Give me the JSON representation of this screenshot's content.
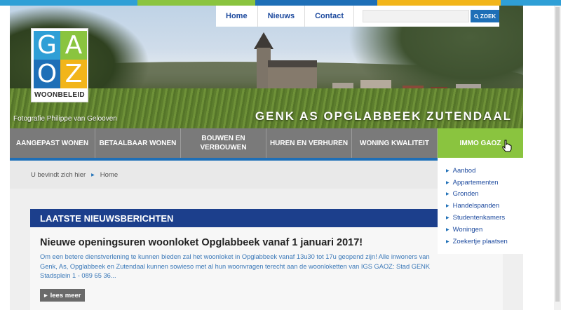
{
  "colors": {
    "top_strip": [
      "#2f9fd6",
      "#8ac43f",
      "#1e6fb7",
      "#f2b51a",
      "#2f9fd6"
    ],
    "logo_cells": [
      "#2f9fd6",
      "#8ac43f",
      "#1e6fb7",
      "#f2b51a"
    ],
    "accent_blue": "#1c3f8c",
    "active_green": "#8ac43f"
  },
  "logo": {
    "letters": [
      "G",
      "A",
      "O",
      "Z"
    ],
    "subtitle": "WOONBELEID"
  },
  "header": {
    "photo_credit": "Fotografie Philippe van Gelooven",
    "tagline": "GENK AS OPGLABBEEK ZUTENDAAL"
  },
  "topnav": {
    "links": [
      "Home",
      "Nieuws",
      "Contact"
    ],
    "search_placeholder": "",
    "search_button": "ZOEK",
    "search_icon": "search-icon"
  },
  "mainnav": {
    "items": [
      {
        "label": "AANGEPAST WONEN"
      },
      {
        "label": "BETAALBAAR WONEN"
      },
      {
        "label": "BOUWEN EN VERBOUWEN"
      },
      {
        "label": "HUREN EN VERHUREN"
      },
      {
        "label": "WONING KWALITEIT"
      },
      {
        "label": "IMMO GAOZ"
      }
    ]
  },
  "dropdown": {
    "items": [
      "Aanbod",
      "Appartementen",
      "Gronden",
      "Handelspanden",
      "Studentenkamers",
      "Woningen",
      "Zoekertje plaatsen"
    ]
  },
  "breadcrumb": {
    "prefix": "U bevindt zich hier",
    "current": "Home"
  },
  "news": {
    "header": "LAATSTE NIEUWSBERICHTEN",
    "title": "Nieuwe openingsuren woonloket Opglabbeek vanaf 1 januari 2017!",
    "excerpt": "Om een betere dienstverlening te kunnen bieden zal het woonloket in Opglabbeek vanaf 13u30 tot 17u geopend zijn! Alle inwoners van Genk, As, Opglabbeek en Zutendaal kunnen sowieso met al hun woonvragen terecht aan de woonloketten van IGS GAOZ: Stad GENK Stadsplein 1 - 089 65 36...",
    "read_more": "lees meer"
  }
}
